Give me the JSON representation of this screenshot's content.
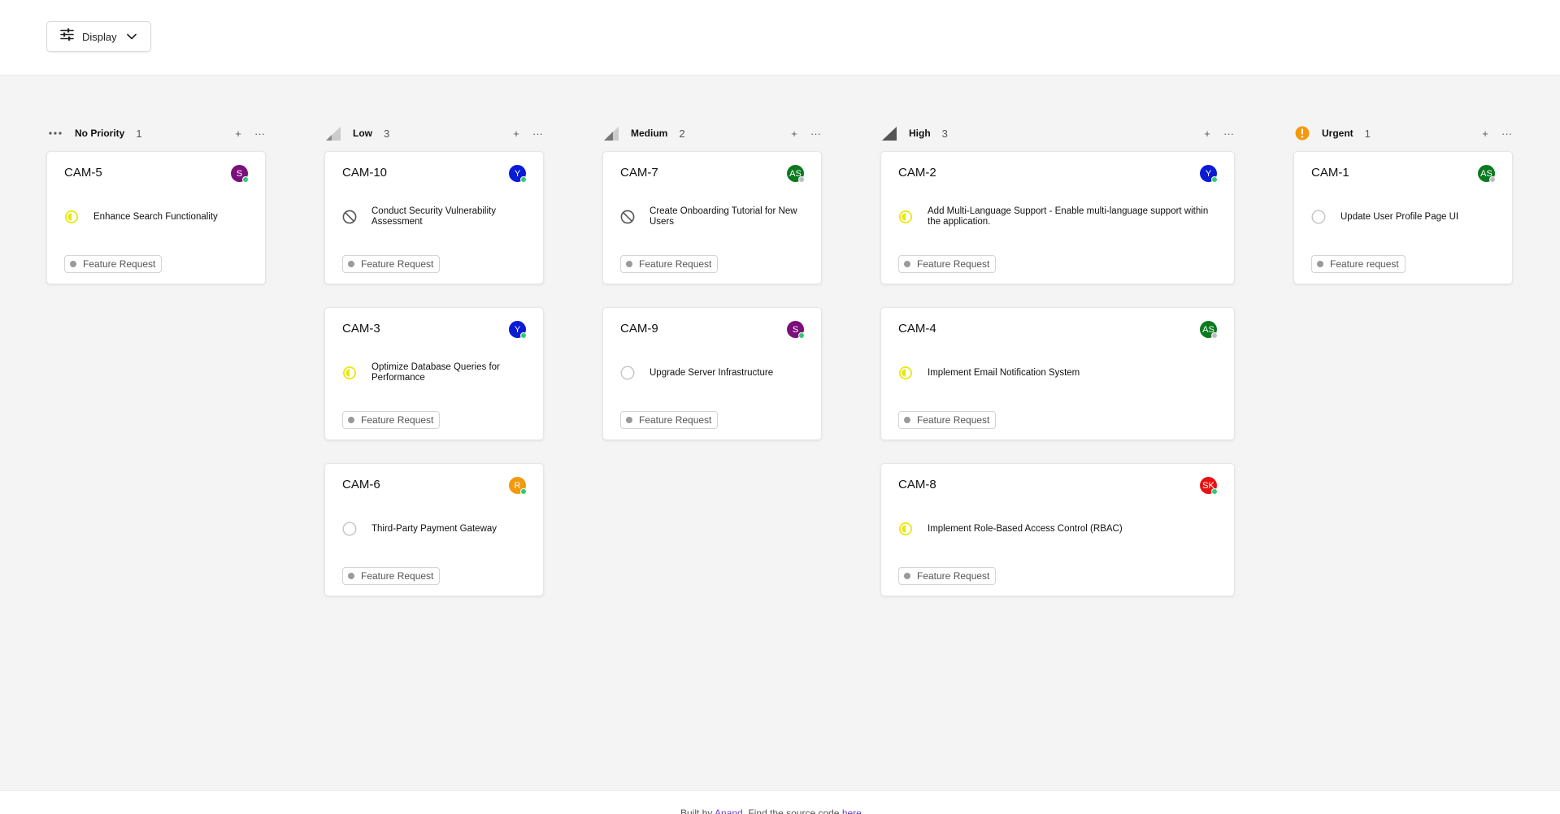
{
  "toolbar": {
    "display_label": "Display"
  },
  "columns": [
    {
      "title": "No Priority",
      "count": "1",
      "priority_icon": "dots-icon",
      "cards": [
        {
          "id": "CAM-5",
          "avatar": "S",
          "avatar_color": "#7b0f7b",
          "online_color": "#2ecc71",
          "status": "in-progress",
          "title": "Enhance Search Functionality",
          "tag": "Feature Request"
        }
      ]
    },
    {
      "title": "Low",
      "count": "3",
      "priority_icon": "signal-low-icon",
      "cards": [
        {
          "id": "CAM-10",
          "avatar": "Y",
          "avatar_color": "#0a1bd6",
          "online_color": "#2ecc71",
          "status": "cancelled",
          "title": "Conduct Security Vulnerability Assessment",
          "tag": "Feature Request"
        },
        {
          "id": "CAM-3",
          "avatar": "Y",
          "avatar_color": "#0a1bd6",
          "online_color": "#2ecc71",
          "status": "in-progress",
          "title": "Optimize Database Queries for Performance",
          "tag": "Feature Request"
        },
        {
          "id": "CAM-6",
          "avatar": "R",
          "avatar_color": "#f29a0c",
          "online_color": "#2ecc71",
          "status": "todo",
          "title": "Third-Party Payment Gateway",
          "tag": "Feature Request"
        }
      ]
    },
    {
      "title": "Medium",
      "count": "2",
      "priority_icon": "signal-medium-icon",
      "cards": [
        {
          "id": "CAM-7",
          "avatar": "AS",
          "avatar_color": "#0a7a1e",
          "online_color": "#bdbdbd",
          "status": "cancelled",
          "title": "Create Onboarding Tutorial for New Users",
          "tag": "Feature Request"
        },
        {
          "id": "CAM-9",
          "avatar": "S",
          "avatar_color": "#7b0f7b",
          "online_color": "#2ecc71",
          "status": "todo",
          "title": "Upgrade Server Infrastructure",
          "tag": "Feature Request"
        }
      ]
    },
    {
      "title": "High",
      "count": "3",
      "priority_icon": "signal-high-icon",
      "cards": [
        {
          "id": "CAM-2",
          "avatar": "Y",
          "avatar_color": "#0a1bd6",
          "online_color": "#2ecc71",
          "status": "in-progress",
          "title": "Add Multi-Language Support - Enable multi-language support within the application.",
          "tag": "Feature Request"
        },
        {
          "id": "CAM-4",
          "avatar": "AS",
          "avatar_color": "#0a7a1e",
          "online_color": "#bdbdbd",
          "status": "in-progress",
          "title": "Implement Email Notification System",
          "tag": "Feature Request"
        },
        {
          "id": "CAM-8",
          "avatar": "SK",
          "avatar_color": "#e81212",
          "online_color": "#2ecc71",
          "status": "in-progress",
          "title": "Implement Role-Based Access Control (RBAC)",
          "tag": "Feature Request"
        }
      ]
    },
    {
      "title": "Urgent",
      "count": "1",
      "priority_icon": "urgent-alert-icon",
      "cards": [
        {
          "id": "CAM-1",
          "avatar": "AS",
          "avatar_color": "#0a7a1e",
          "online_color": "#bdbdbd",
          "status": "todo",
          "title": "Update User Profile Page UI",
          "tag": "Feature request"
        }
      ]
    }
  ],
  "colors": {
    "in_progress": "#e8e810",
    "urgent": "#f29a0c"
  },
  "footer": {
    "prefix": "Built by ",
    "author": "Anand",
    "middle": ". Find the source code ",
    "link": "here",
    "suffix": "."
  }
}
